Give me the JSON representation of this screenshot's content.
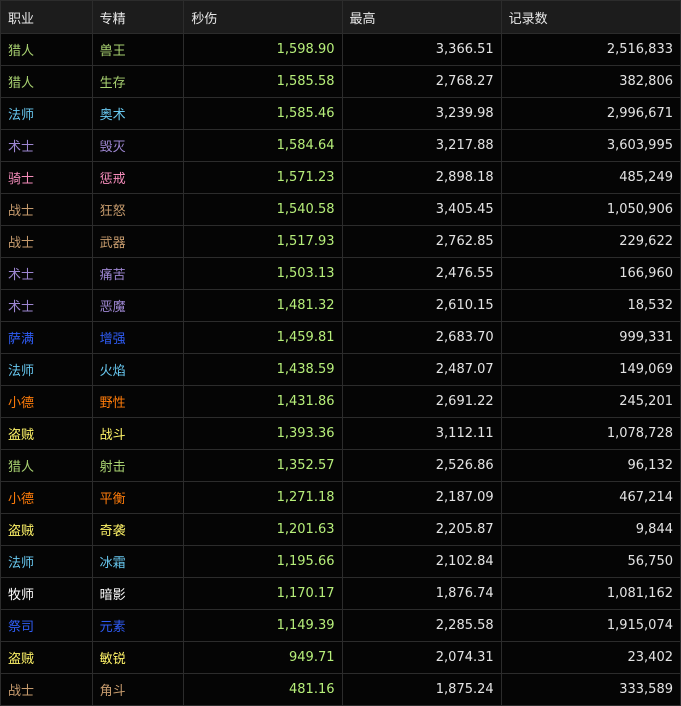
{
  "colors": {
    "猎人": "#a9d271",
    "法师": "#68c8f0",
    "术士": "#9d86d1",
    "骑士": "#f48cba",
    "战士": "#c69b6d",
    "萨满": "#2f5cf5",
    "小德": "#ff7c0a",
    "盗贼": "#fff468",
    "牧师": "#ffffff",
    "祭司": "#2f5cf5",
    "dps": "#b7ef7a"
  },
  "headers": [
    "职业",
    "专精",
    "秒伤",
    "最高",
    "记录数"
  ],
  "rows": [
    {
      "cls": "猎人",
      "spec": "兽王",
      "dps": "1,598.90",
      "max": "3,366.51",
      "count": "2,516,833"
    },
    {
      "cls": "猎人",
      "spec": "生存",
      "dps": "1,585.58",
      "max": "2,768.27",
      "count": "382,806"
    },
    {
      "cls": "法师",
      "spec": "奥术",
      "dps": "1,585.46",
      "max": "3,239.98",
      "count": "2,996,671"
    },
    {
      "cls": "术士",
      "spec": "毁灭",
      "dps": "1,584.64",
      "max": "3,217.88",
      "count": "3,603,995"
    },
    {
      "cls": "骑士",
      "spec": "惩戒",
      "dps": "1,571.23",
      "max": "2,898.18",
      "count": "485,249"
    },
    {
      "cls": "战士",
      "spec": "狂怒",
      "dps": "1,540.58",
      "max": "3,405.45",
      "count": "1,050,906"
    },
    {
      "cls": "战士",
      "spec": "武器",
      "dps": "1,517.93",
      "max": "2,762.85",
      "count": "229,622"
    },
    {
      "cls": "术士",
      "spec": "痛苦",
      "dps": "1,503.13",
      "max": "2,476.55",
      "count": "166,960"
    },
    {
      "cls": "术士",
      "spec": "恶魔",
      "dps": "1,481.32",
      "max": "2,610.15",
      "count": "18,532"
    },
    {
      "cls": "萨满",
      "spec": "增强",
      "dps": "1,459.81",
      "max": "2,683.70",
      "count": "999,331"
    },
    {
      "cls": "法师",
      "spec": "火焰",
      "dps": "1,438.59",
      "max": "2,487.07",
      "count": "149,069"
    },
    {
      "cls": "小德",
      "spec": "野性",
      "dps": "1,431.86",
      "max": "2,691.22",
      "count": "245,201"
    },
    {
      "cls": "盗贼",
      "spec": "战斗",
      "dps": "1,393.36",
      "max": "3,112.11",
      "count": "1,078,728"
    },
    {
      "cls": "猎人",
      "spec": "射击",
      "dps": "1,352.57",
      "max": "2,526.86",
      "count": "96,132"
    },
    {
      "cls": "小德",
      "spec": "平衡",
      "dps": "1,271.18",
      "max": "2,187.09",
      "count": "467,214"
    },
    {
      "cls": "盗贼",
      "spec": "奇袭",
      "dps": "1,201.63",
      "max": "2,205.87",
      "count": "9,844"
    },
    {
      "cls": "法师",
      "spec": "冰霜",
      "dps": "1,195.66",
      "max": "2,102.84",
      "count": "56,750"
    },
    {
      "cls": "牧师",
      "spec": "暗影",
      "dps": "1,170.17",
      "max": "1,876.74",
      "count": "1,081,162"
    },
    {
      "cls": "祭司",
      "spec": "元素",
      "dps": "1,149.39",
      "max": "2,285.58",
      "count": "1,915,074"
    },
    {
      "cls": "盗贼",
      "spec": "敏锐",
      "dps": "949.71",
      "max": "2,074.31",
      "count": "23,402"
    },
    {
      "cls": "战士",
      "spec": "角斗",
      "dps": "481.16",
      "max": "1,875.24",
      "count": "333,589"
    }
  ]
}
